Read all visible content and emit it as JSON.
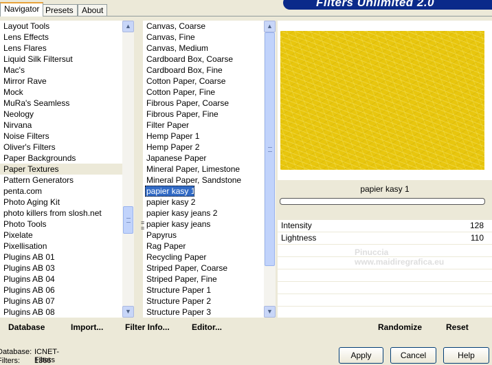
{
  "title": "Filters Unlimited 2.0",
  "tabs": [
    "Navigator",
    "Presets",
    "About"
  ],
  "categories": [
    "Layout Tools",
    "Lens Effects",
    "Lens Flares",
    "Liquid Silk Filtersut",
    "Mac's",
    "Mirror Rave",
    "Mock",
    "MuRa's Seamless",
    "Neology",
    "Nirvana",
    "Noise Filters",
    "Oliver's Filters",
    "Paper Backgrounds",
    "Paper Textures",
    "Pattern Generators",
    "penta.com",
    "Photo Aging Kit",
    "photo killers from slosh.net",
    "Photo Tools",
    "Pixelate",
    "Pixellisation",
    "Plugins AB 01",
    "Plugins AB 03",
    "Plugins AB 04",
    "Plugins AB 06",
    "Plugins AB 07",
    "Plugins AB 08"
  ],
  "filters": [
    "Canvas, Coarse",
    "Canvas, Fine",
    "Canvas, Medium",
    "Cardboard Box, Coarse",
    "Cardboard Box, Fine",
    "Cotton Paper, Coarse",
    "Cotton Paper, Fine",
    "Fibrous Paper, Coarse",
    "Fibrous Paper, Fine",
    "Filter Paper",
    "Hemp Paper 1",
    "Hemp Paper 2",
    "Japanese Paper",
    "Mineral Paper, Limestone",
    "Mineral Paper, Sandstone",
    "papier kasy 1",
    "papier kasy 2",
    "papier kasy jeans 2",
    "papier kasy jeans",
    "Papyrus",
    "Rag Paper",
    "Recycling Paper",
    "Striped Paper, Coarse",
    "Striped Paper, Fine",
    "Structure Paper 1",
    "Structure Paper 2",
    "Structure Paper 3"
  ],
  "selected_category": "Paper Textures",
  "selected_filter": "papier kasy 1",
  "filter_name": "papier kasy 1",
  "params": [
    {
      "label": "Intensity",
      "value": "128"
    },
    {
      "label": "Lightness",
      "value": "110"
    }
  ],
  "watermark": {
    "name": "Pinuccia",
    "url": "www.maidiregrafica.eu"
  },
  "left_buttons": {
    "database": "Database",
    "import": "Import...",
    "filter_info": "Filter Info...",
    "editor": "Editor..."
  },
  "right_buttons": {
    "randomize": "Randomize",
    "reset": "Reset"
  },
  "status": {
    "database_label": "Database:",
    "database_value": "ICNET-Filters",
    "filters_label": "Filters:",
    "filters_value": "1366"
  },
  "dialog": {
    "apply": "Apply",
    "cancel": "Cancel",
    "help": "Help"
  },
  "preview_color": "#e8c60e"
}
